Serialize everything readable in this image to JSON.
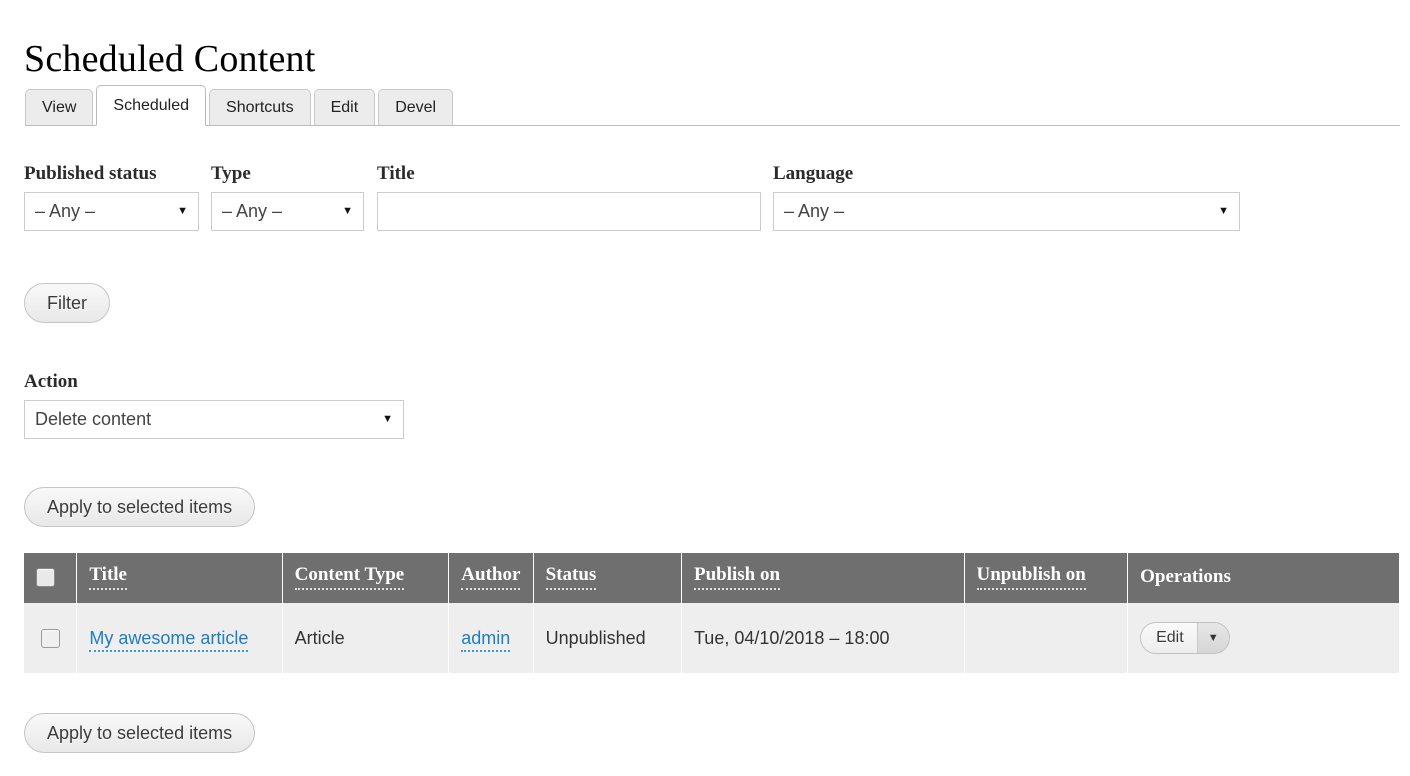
{
  "page": {
    "title": "Scheduled Content"
  },
  "tabs": [
    {
      "label": "View",
      "active": false
    },
    {
      "label": "Scheduled",
      "active": true
    },
    {
      "label": "Shortcuts",
      "active": false
    },
    {
      "label": "Edit",
      "active": false
    },
    {
      "label": "Devel",
      "active": false
    }
  ],
  "filters": {
    "published_status": {
      "label": "Published status",
      "value": "– Any –"
    },
    "type": {
      "label": "Type",
      "value": "– Any –"
    },
    "title": {
      "label": "Title",
      "value": "",
      "placeholder": ""
    },
    "language": {
      "label": "Language",
      "value": "– Any –"
    },
    "filter_button": "Filter"
  },
  "action": {
    "label": "Action",
    "value": "Delete content",
    "apply_button_top": "Apply to selected items",
    "apply_button_bottom": "Apply to selected items"
  },
  "table": {
    "columns": [
      {
        "key": "check",
        "label": "",
        "sortable": false
      },
      {
        "key": "title",
        "label": "Title",
        "sortable": true
      },
      {
        "key": "content_type",
        "label": "Content Type",
        "sortable": true
      },
      {
        "key": "author",
        "label": "Author",
        "sortable": true
      },
      {
        "key": "status",
        "label": "Status",
        "sortable": true
      },
      {
        "key": "publish_on",
        "label": "Publish on",
        "sortable": true
      },
      {
        "key": "unpublish_on",
        "label": "Unpublish on",
        "sortable": true
      },
      {
        "key": "operations",
        "label": "Operations",
        "sortable": false
      }
    ],
    "rows": [
      {
        "title": "My awesome article",
        "content_type": "Article",
        "author": "admin",
        "status": "Unpublished",
        "publish_on": "Tue, 04/10/2018 – 18:00",
        "unpublish_on": "",
        "operation_label": "Edit"
      }
    ]
  },
  "icons": {
    "caret_down": "▼",
    "select_all_checkbox": "checkbox-icon",
    "row_checkbox": "checkbox-icon"
  },
  "colors": {
    "table_header_bg": "#6f6f6f",
    "row_bg": "#eeeeee",
    "link": "#1e7ec2",
    "page_bg": "#ffffff"
  }
}
